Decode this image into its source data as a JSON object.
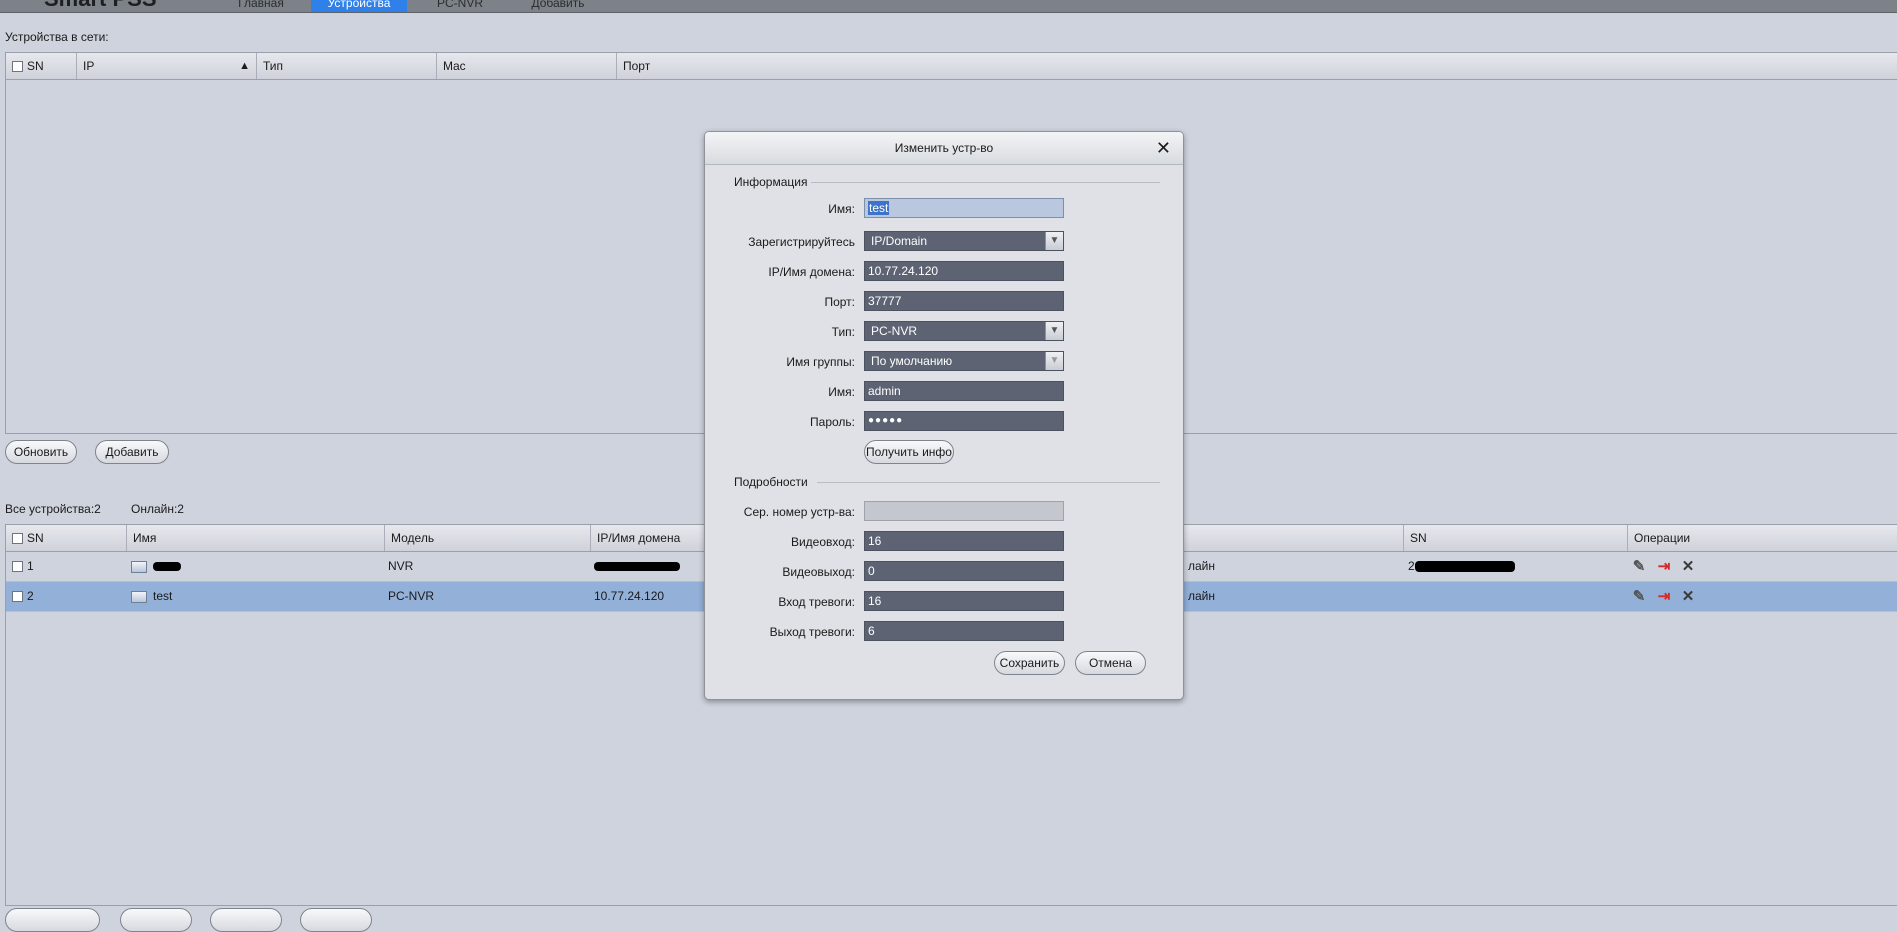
{
  "app": {
    "title": "Smart PSS"
  },
  "nav": {
    "tabs": [
      "Главная",
      "Устройства",
      "PC-NVR",
      "Добавить"
    ],
    "active": "Устройства"
  },
  "online_devices": {
    "label": "Устройства в сети:",
    "columns": [
      "SN",
      "IP",
      "Тип",
      "Mac",
      "Порт"
    ],
    "sort_indicator": "▲"
  },
  "actions": {
    "refresh": "Обновить",
    "add": "Добавить"
  },
  "summary": {
    "all": "Все устройства:2",
    "online": "Онлайн:2"
  },
  "devices": {
    "columns": [
      "SN",
      "Имя",
      "Модель",
      "IP/Имя домена",
      "SN",
      "Операции"
    ],
    "rows": [
      {
        "sn": "1",
        "name": "",
        "model": "NVR",
        "ip": "",
        "status": "лайн",
        "serial_prefix": "2"
      },
      {
        "sn": "2",
        "name": "test",
        "model": "PC-NVR",
        "ip": "10.77.24.120",
        "status": "лайн",
        "serial_prefix": ""
      }
    ]
  },
  "dialog": {
    "title": "Изменить устр-во",
    "close": "✕",
    "info_group": "Информация",
    "details_group": "Подробности",
    "labels": {
      "name": "Имя:",
      "register": "Зарегистрируйтесь",
      "ip": "IP/Имя домена:",
      "port": "Порт:",
      "type": "Тип:",
      "group": "Имя группы:",
      "user": "Имя:",
      "password": "Пароль:",
      "serial": "Сер. номер устр-ва:",
      "video_in": "Видеовход:",
      "video_out": "Видеовыход:",
      "alarm_in": "Вход тревоги:",
      "alarm_out": "Выход тревоги:"
    },
    "values": {
      "name": "test",
      "register": "IP/Domain",
      "ip": "10.77.24.120",
      "port": "37777",
      "type": "PC-NVR",
      "group": "По умолчанию",
      "user": "admin",
      "password": "●●●●●",
      "serial": "",
      "video_in": "16",
      "video_out": "0",
      "alarm_in": "16",
      "alarm_out": "6"
    },
    "get_info": "Получить инфо",
    "save": "Сохранить",
    "cancel": "Отмена"
  },
  "icons": {
    "edit": "pencil-icon",
    "export": "export-icon",
    "delete": "delete-icon",
    "dropdown": "chevron-down-icon"
  },
  "colors": {
    "accent": "#2f80e8",
    "selected_row": "#93b0d8",
    "field_bg": "#5d6373",
    "delete": "#3a3a3a",
    "export": "#d62b2b"
  }
}
